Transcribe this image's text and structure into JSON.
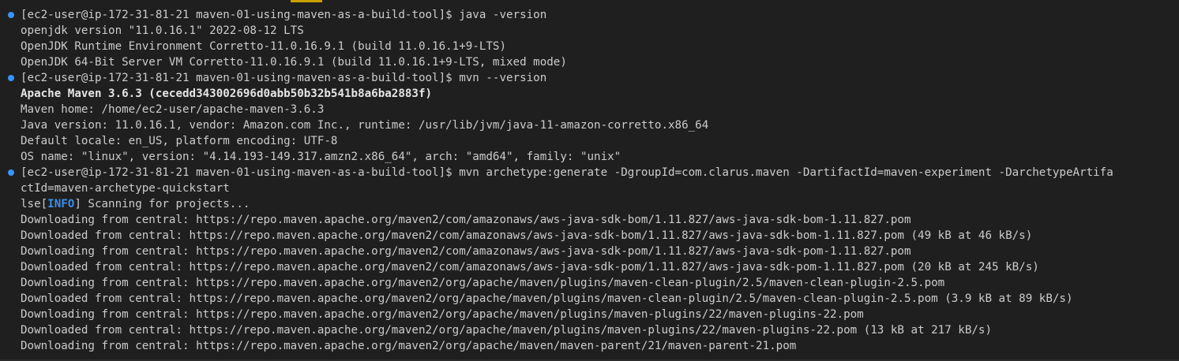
{
  "terminal": {
    "accent_color": "#3794ff",
    "info_color": "#3b8eea",
    "lines": [
      {
        "prompt": true,
        "text": "[ec2-user@ip-172-31-81-21 maven-01-using-maven-as-a-build-tool]$ java -version"
      },
      {
        "text": "openjdk version \"11.0.16.1\" 2022-08-12 LTS"
      },
      {
        "text": "OpenJDK Runtime Environment Corretto-11.0.16.9.1 (build 11.0.16.1+9-LTS)"
      },
      {
        "text": "OpenJDK 64-Bit Server VM Corretto-11.0.16.9.1 (build 11.0.16.1+9-LTS, mixed mode)"
      },
      {
        "prompt": true,
        "text": "[ec2-user@ip-172-31-81-21 maven-01-using-maven-as-a-build-tool]$ mvn --version"
      },
      {
        "bold": true,
        "text": "Apache Maven 3.6.3 (cecedd343002696d0abb50b32b541b8a6ba2883f)"
      },
      {
        "text": "Maven home: /home/ec2-user/apache-maven-3.6.3"
      },
      {
        "text": "Java version: 11.0.16.1, vendor: Amazon.com Inc., runtime: /usr/lib/jvm/java-11-amazon-corretto.x86_64"
      },
      {
        "text": "Default locale: en_US, platform encoding: UTF-8"
      },
      {
        "text": "OS name: \"linux\", version: \"4.14.193-149.317.amzn2.x86_64\", arch: \"amd64\", family: \"unix\""
      },
      {
        "prompt": true,
        "text": "[ec2-user@ip-172-31-81-21 maven-01-using-maven-as-a-build-tool]$ mvn archetype:generate -DgroupId=com.clarus.maven -DartifactId=maven-experiment -DarchetypeArtifa"
      },
      {
        "text": "ctId=maven-archetype-quickstart"
      },
      {
        "info": true,
        "prefix": "lse[",
        "tag": "INFO",
        "suffix": "] Scanning for projects..."
      },
      {
        "text": "Downloading from central: https://repo.maven.apache.org/maven2/com/amazonaws/aws-java-sdk-bom/1.11.827/aws-java-sdk-bom-1.11.827.pom"
      },
      {
        "text": "Downloaded from central: https://repo.maven.apache.org/maven2/com/amazonaws/aws-java-sdk-bom/1.11.827/aws-java-sdk-bom-1.11.827.pom (49 kB at 46 kB/s)"
      },
      {
        "text": "Downloading from central: https://repo.maven.apache.org/maven2/com/amazonaws/aws-java-sdk-pom/1.11.827/aws-java-sdk-pom-1.11.827.pom"
      },
      {
        "text": "Downloaded from central: https://repo.maven.apache.org/maven2/com/amazonaws/aws-java-sdk-pom/1.11.827/aws-java-sdk-pom-1.11.827.pom (20 kB at 245 kB/s)"
      },
      {
        "text": "Downloading from central: https://repo.maven.apache.org/maven2/org/apache/maven/plugins/maven-clean-plugin/2.5/maven-clean-plugin-2.5.pom"
      },
      {
        "text": "Downloaded from central: https://repo.maven.apache.org/maven2/org/apache/maven/plugins/maven-clean-plugin/2.5/maven-clean-plugin-2.5.pom (3.9 kB at 89 kB/s)"
      },
      {
        "text": "Downloading from central: https://repo.maven.apache.org/maven2/org/apache/maven/plugins/maven-plugins/22/maven-plugins-22.pom"
      },
      {
        "text": "Downloaded from central: https://repo.maven.apache.org/maven2/org/apache/maven/plugins/maven-plugins/22/maven-plugins-22.pom (13 kB at 217 kB/s)"
      },
      {
        "text": "Downloading from central: https://repo.maven.apache.org/maven2/org/apache/maven/maven-parent/21/maven-parent-21.pom"
      }
    ]
  }
}
